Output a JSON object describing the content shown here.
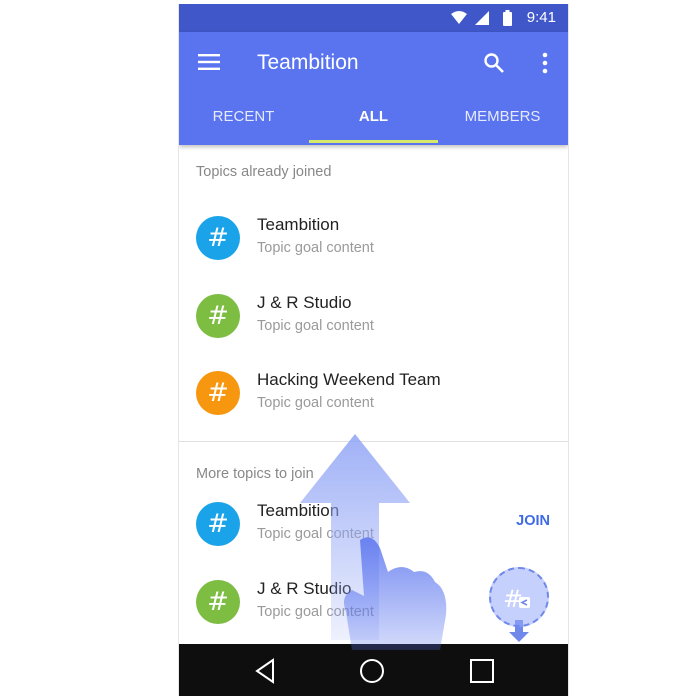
{
  "status_bar": {
    "time": "9:41",
    "icons": [
      "wifi-icon",
      "signal-icon",
      "battery-icon"
    ]
  },
  "app_bar": {
    "title": "Teambition",
    "icons": [
      "menu-icon",
      "search-icon",
      "more-vert-icon"
    ],
    "color": "#5a73ef"
  },
  "tabs": [
    {
      "label": "RECENT"
    },
    {
      "label": "ALL"
    },
    {
      "label": "MEMBERS"
    }
  ],
  "active_tab": "ALL",
  "joined": {
    "header": "Topics already joined",
    "items": [
      {
        "title": "Teambition",
        "subtitle": "Topic goal content",
        "icon": "hash-icon",
        "color": "#1aa3e8"
      },
      {
        "title": "J & R Studio",
        "subtitle": "Topic goal content",
        "icon": "hash-icon",
        "color": "#7cbd42"
      },
      {
        "title": "Hacking Weekend Team",
        "subtitle": "Topic goal content",
        "icon": "hash-icon",
        "color": "#f7960f"
      }
    ]
  },
  "more": {
    "header": "More topics to join",
    "join_label": "JOIN",
    "items": [
      {
        "title": "Teambition",
        "subtitle": "Topic goal content",
        "icon": "hash-icon",
        "color": "#1aa3e8"
      },
      {
        "title": "J & R Studio",
        "subtitle": "Topic goal content",
        "icon": "hash-icon",
        "color": "#7cbd42"
      }
    ]
  },
  "fab": {
    "icon": "hash-add-icon"
  },
  "nav_bar": {
    "icons": [
      "back-icon",
      "home-icon",
      "recents-icon"
    ]
  },
  "gesture": {
    "hint": "swipe-up-arrow",
    "hand": "hand-pointer-icon"
  },
  "avatar_glyph": "#"
}
